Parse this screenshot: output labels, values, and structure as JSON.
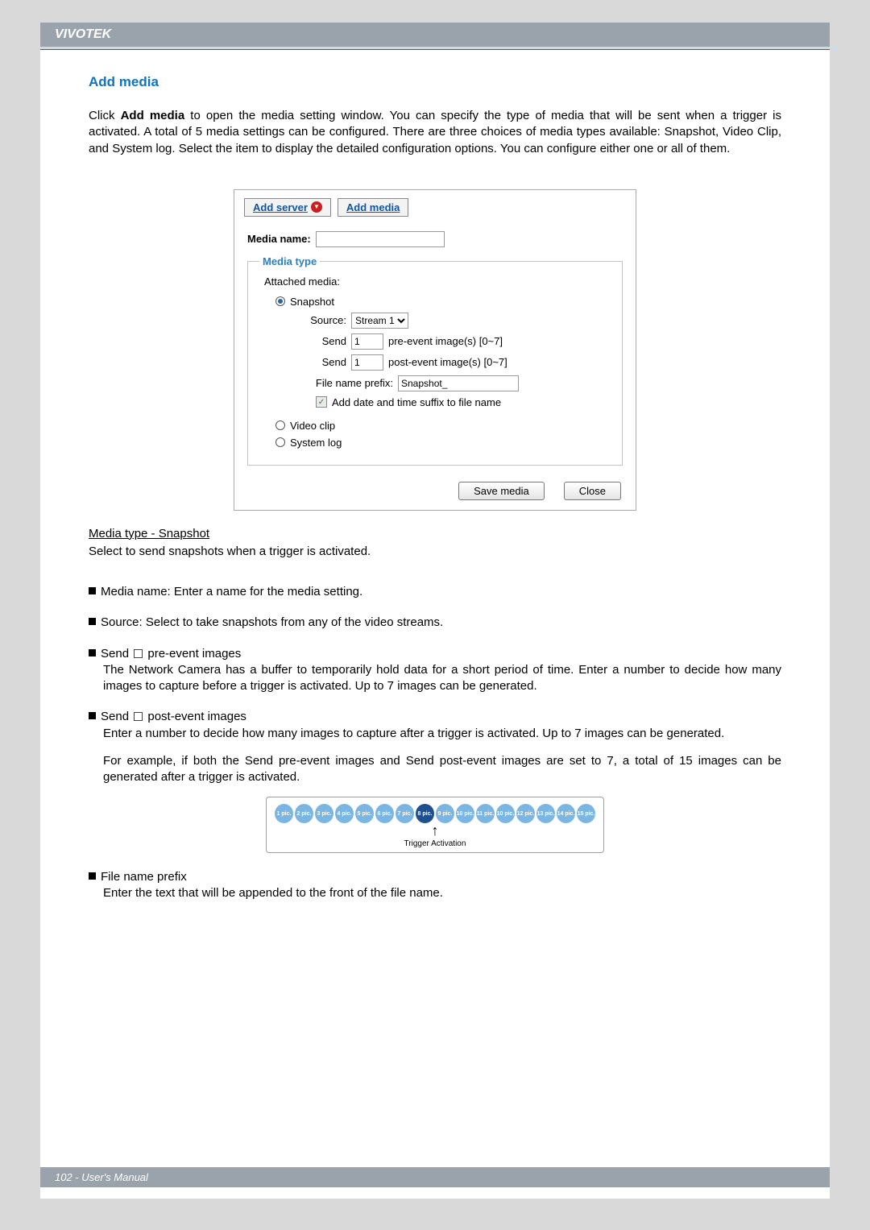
{
  "header": {
    "brand": "VIVOTEK"
  },
  "section": {
    "title": "Add media"
  },
  "intro": {
    "pre": "Click ",
    "bold": "Add media",
    "post": " to open the media setting window. You can specify the type of media that will be sent when a trigger is activated. A total of 5 media settings can be configured. There are three choices of media types available: Snapshot, Video Clip, and System log. Select the item to display the detailed configuration options. You can configure either one or all of them."
  },
  "panel": {
    "tabs": {
      "add_server": "Add server",
      "add_media": "Add media"
    },
    "media_name_label": "Media name:",
    "media_name_value": "",
    "fieldset_legend": "Media type",
    "attached_label": "Attached media:",
    "options": {
      "snapshot": "Snapshot",
      "video_clip": "Video clip",
      "system_log": "System log"
    },
    "snapshot": {
      "source_label": "Source:",
      "source_value": "Stream 1",
      "send1_label": "Send",
      "send1_value": "1",
      "send1_suffix": "pre-event image(s) [0~7]",
      "send2_label": "Send",
      "send2_value": "1",
      "send2_suffix": "post-event image(s) [0~7]",
      "prefix_label": "File name prefix:",
      "prefix_value": "Snapshot_",
      "suffix_checkbox": "Add date and time suffix to file name"
    },
    "actions": {
      "save": "Save media",
      "close": "Close"
    }
  },
  "subhead": "Media type - Snapshot",
  "subhead_desc": "Select to send snapshots when a trigger is activated.",
  "bullets": {
    "b1": "Media name: Enter a name for the media setting.",
    "b2": "Source: Select to take snapshots from any of the video streams.",
    "b3_lead": "Send ",
    "b3_tail": " pre-event images",
    "b3_body": "The Network Camera has a buffer to temporarily hold data for a short period of time. Enter a number to decide how many images to capture before a trigger is activated. Up to 7 images can be generated.",
    "b4_lead": "Send ",
    "b4_tail": " post-event images",
    "b4_body": "Enter a number to decide how many images to capture after a trigger is activated. Up to 7 images can be generated.",
    "b4_example": "For example, if both the Send pre-event images and Send post-event images are set to 7, a total of 15 images can be generated after a trigger is activated.",
    "b5_head": "File name prefix",
    "b5_body": "Enter the text that will be appended to the front of the file name."
  },
  "diagram": {
    "labels": [
      "1 pic.",
      "2 pic.",
      "3 pic.",
      "4 pic.",
      "5 pic.",
      "6 pic.",
      "7 pic.",
      "8 pic.",
      "9 pic.",
      "10 pic.",
      "11 pic.",
      "10 pic.",
      "12 pic.",
      "13 pic.",
      "14 pic.",
      "15 pic."
    ],
    "caption": "Trigger Activation"
  },
  "footer": {
    "text": "102 - User's Manual"
  }
}
